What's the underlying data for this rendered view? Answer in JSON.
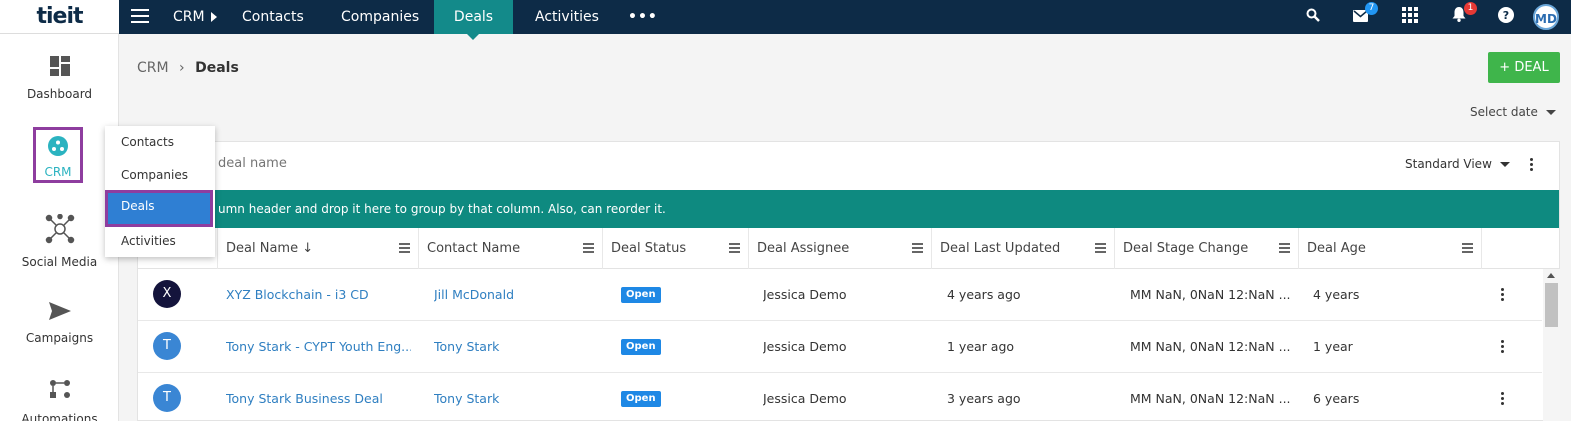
{
  "brand": {
    "logo_text": "tieit"
  },
  "topnav": {
    "crm_label": "CRM",
    "items": [
      "Contacts",
      "Companies",
      "Deals",
      "Activities"
    ],
    "more_label": "•••",
    "mail_badge": "7",
    "notification_badge": "1",
    "avatar_initials": "MD"
  },
  "sidebar": {
    "items": [
      {
        "label": "Dashboard",
        "icon": "dashboard-icon"
      },
      {
        "label": "CRM",
        "icon": "crm-icon"
      },
      {
        "label": "Social Media",
        "icon": "social-media-icon"
      },
      {
        "label": "Campaigns",
        "icon": "campaigns-icon"
      },
      {
        "label": "Automations",
        "icon": "automations-icon"
      }
    ]
  },
  "crm_menu": {
    "items": [
      "Contacts",
      "Companies",
      "Deals",
      "Activities"
    ]
  },
  "breadcrumb": {
    "root": "CRM",
    "separator": "›",
    "current": "Deals"
  },
  "actions": {
    "add_deal_label": "+   DEAL",
    "select_date_label": "Select date"
  },
  "grid": {
    "search_placeholder": "deal name",
    "view_label": "Standard View",
    "group_hint": "umn header and drop it here to group by that column. Also, can reorder it.",
    "columns": [
      "Deal Name ↓",
      "Contact Name",
      "Deal Status",
      "Deal Assignee",
      "Deal Last Updated",
      "Deal Stage Change",
      "Deal Age"
    ],
    "rows": [
      {
        "initial": "X",
        "avatar_color": "#14143c",
        "deal_name": "XYZ Blockchain - i3 CD",
        "contact": "Jill McDonald",
        "status": "Open",
        "assignee": "Jessica Demo",
        "last_updated": "4 years ago",
        "stage_change": "MM NaN, 0NaN 12:NaN ...",
        "age": "4 years"
      },
      {
        "initial": "T",
        "avatar_color": "#3a86d4",
        "deal_name": "Tony Stark - CYPT Youth Eng...",
        "contact": "Tony Stark",
        "status": "Open",
        "assignee": "Jessica Demo",
        "last_updated": "1 year ago",
        "stage_change": "MM NaN, 0NaN 12:NaN ...",
        "age": "1 year"
      },
      {
        "initial": "T",
        "avatar_color": "#3a86d4",
        "deal_name": "Tony Stark Business Deal",
        "contact": "Tony Stark",
        "status": "Open",
        "assignee": "Jessica Demo",
        "last_updated": "3 years ago",
        "stage_change": "MM NaN, 0NaN 12:NaN ...",
        "age": "6 years"
      }
    ]
  },
  "colors": {
    "nav_bg": "#0d2b47",
    "active_tab": "#138a8a",
    "group_bar": "#0e8a80",
    "add_button": "#3fb54b",
    "highlight_border": "#8e3d9f",
    "link": "#2f7fc1"
  }
}
